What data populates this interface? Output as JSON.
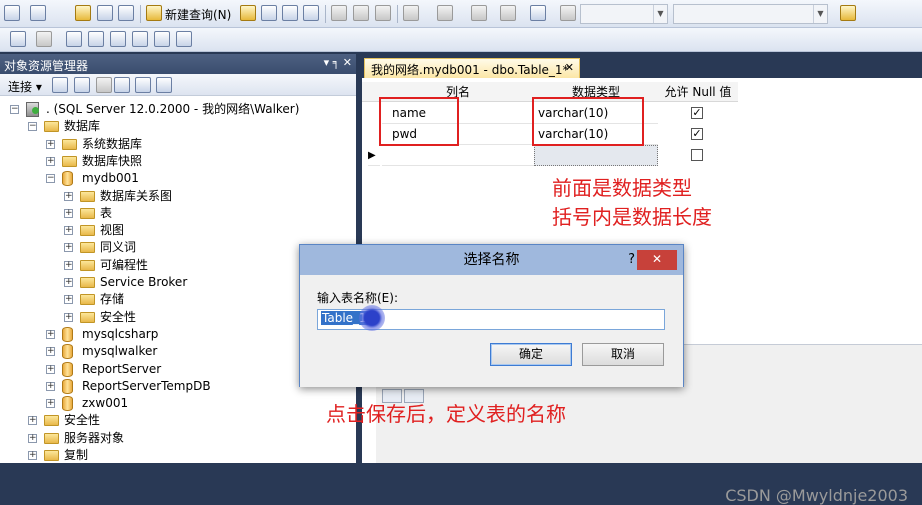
{
  "toolbar": {
    "new_query_label": "新建查询(N)"
  },
  "object_explorer": {
    "title": "对象资源管理器",
    "pin": "▾ ╕ ✕",
    "connect_label": "连接 ▾",
    "tree": [
      {
        "depth": 0,
        "expanded": true,
        "icon": "server-icon",
        "label": ". (SQL Server 12.0.2000 - 我的网络\\Walker)"
      },
      {
        "depth": 1,
        "expanded": true,
        "icon": "folder-icon",
        "label": "数据库"
      },
      {
        "depth": 2,
        "expanded": false,
        "icon": "folder-icon",
        "label": "系统数据库"
      },
      {
        "depth": 2,
        "expanded": false,
        "icon": "folder-icon",
        "label": "数据库快照"
      },
      {
        "depth": 2,
        "expanded": true,
        "icon": "database-icon",
        "label": "mydb001"
      },
      {
        "depth": 3,
        "expanded": false,
        "icon": "folder-icon",
        "label": "数据库关系图"
      },
      {
        "depth": 3,
        "expanded": false,
        "icon": "folder-icon",
        "label": "表"
      },
      {
        "depth": 3,
        "expanded": false,
        "icon": "folder-icon",
        "label": "视图"
      },
      {
        "depth": 3,
        "expanded": false,
        "icon": "folder-icon",
        "label": "同义词"
      },
      {
        "depth": 3,
        "expanded": false,
        "icon": "folder-icon",
        "label": "可编程性"
      },
      {
        "depth": 3,
        "expanded": false,
        "icon": "folder-icon",
        "label": "Service Broker"
      },
      {
        "depth": 3,
        "expanded": false,
        "icon": "folder-icon",
        "label": "存储"
      },
      {
        "depth": 3,
        "expanded": false,
        "icon": "folder-icon",
        "label": "安全性"
      },
      {
        "depth": 2,
        "expanded": false,
        "icon": "database-icon",
        "label": "mysqlcsharp"
      },
      {
        "depth": 2,
        "expanded": false,
        "icon": "database-icon",
        "label": "mysqlwalker"
      },
      {
        "depth": 2,
        "expanded": false,
        "icon": "database-icon",
        "label": "ReportServer"
      },
      {
        "depth": 2,
        "expanded": false,
        "icon": "database-icon",
        "label": "ReportServerTempDB"
      },
      {
        "depth": 2,
        "expanded": false,
        "icon": "database-icon",
        "label": "zxw001"
      },
      {
        "depth": 1,
        "expanded": false,
        "icon": "folder-icon",
        "label": "安全性"
      },
      {
        "depth": 1,
        "expanded": false,
        "icon": "folder-icon",
        "label": "服务器对象"
      },
      {
        "depth": 1,
        "expanded": false,
        "icon": "folder-icon",
        "label": "复制"
      }
    ]
  },
  "designer": {
    "tab_label": "我的网络.mydb001 - dbo.Table_1*",
    "tab_close": "✕",
    "headers": {
      "name": "列名",
      "type": "数据类型",
      "nullable": "允许 Null 值"
    },
    "rows": [
      {
        "name": "name",
        "type": "varchar(10)",
        "nullable": true
      },
      {
        "name": "pwd",
        "type": "varchar(10)",
        "nullable": true
      },
      {
        "name": "",
        "type": "",
        "nullable": false
      }
    ],
    "row_marker": "▶"
  },
  "annotations": {
    "type_note_1": "前面是数据类型",
    "type_note_2": "括号内是数据长度",
    "save_note": "点击保存后，定义表的名称"
  },
  "dialog": {
    "title": "选择名称",
    "help": "?",
    "close": "✕",
    "label": "输入表名称(E):",
    "input_value": "Table_1",
    "ok": "确定",
    "cancel": "取消"
  },
  "watermark": "CSDN @Mwyldnje2003",
  "colors": {
    "annotation": "#e02020",
    "selection": "#3372c9",
    "dialog_title": "#9fb8dd",
    "close": "#c7413a"
  }
}
